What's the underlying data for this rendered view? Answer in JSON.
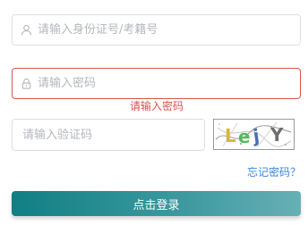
{
  "form": {
    "id_field": {
      "placeholder": "请输入身份证号/考籍号",
      "icon": "user-icon"
    },
    "password_field": {
      "placeholder": "请输入密码",
      "icon": "lock-icon",
      "error": "请输入密码"
    },
    "captcha_field": {
      "placeholder": "请输入验证码"
    },
    "captcha_image": {
      "chars": [
        "L",
        "e",
        "j",
        "Y"
      ]
    },
    "forgot_link": "忘记密码？",
    "login_button": "点击登录"
  },
  "colors": {
    "error": "#d9534f",
    "link": "#3d86d6",
    "button_start": "#107f84",
    "button_end": "#67b0b5"
  }
}
